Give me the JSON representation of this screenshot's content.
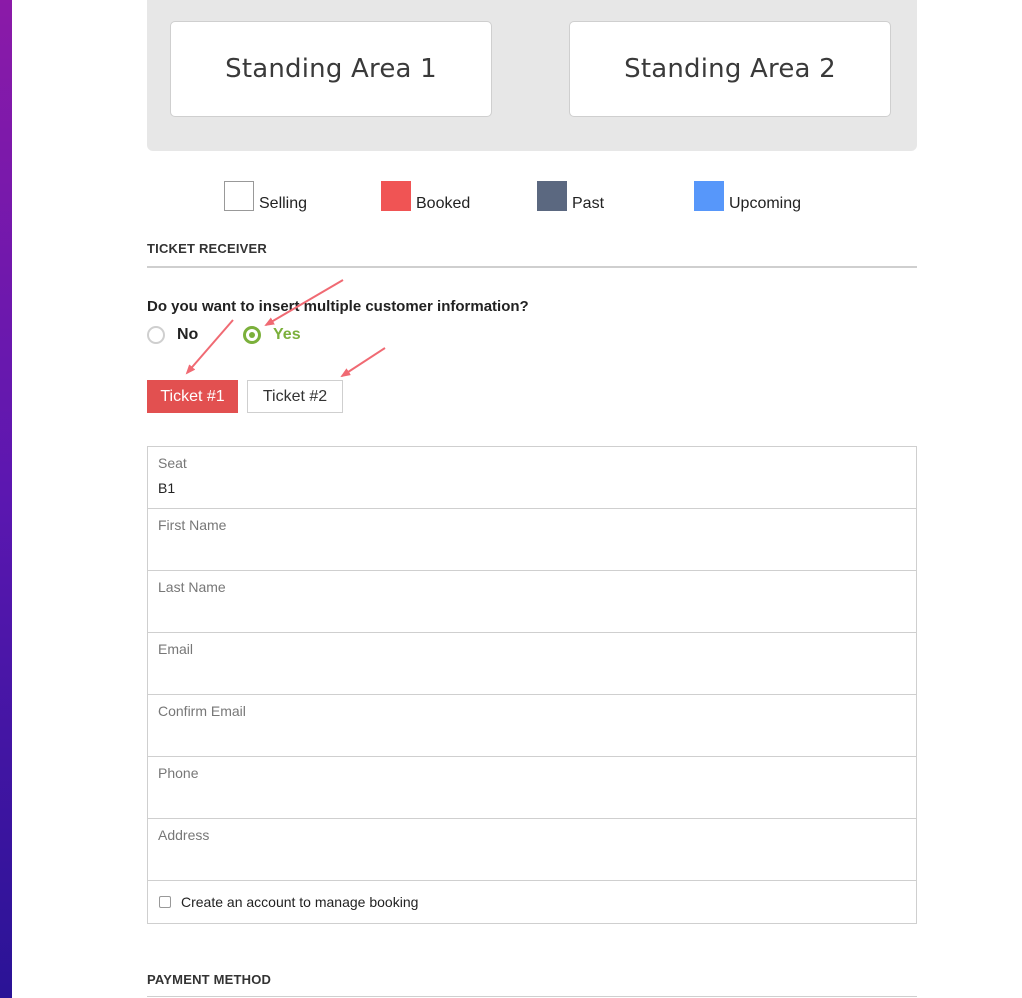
{
  "seat_map": {
    "areas": [
      "Standing Area 1",
      "Standing Area 2"
    ]
  },
  "legend": [
    {
      "label": "Selling",
      "color": "#ffffff"
    },
    {
      "label": "Booked",
      "color": "#f05454"
    },
    {
      "label": "Past",
      "color": "#5b6880"
    },
    {
      "label": "Upcoming",
      "color": "#5797fa"
    }
  ],
  "ticket_receiver": {
    "title": "TICKET RECEIVER",
    "question": "Do you want to insert multiple customer information?",
    "options": {
      "no": "No",
      "yes": "Yes"
    },
    "selected": "yes",
    "tabs": [
      "Ticket #1",
      "Ticket #2"
    ],
    "active_tab": "Ticket #1"
  },
  "form": {
    "fields": [
      {
        "label": "Seat",
        "value": "B1"
      },
      {
        "label": "First Name",
        "value": ""
      },
      {
        "label": "Last Name",
        "value": ""
      },
      {
        "label": "Email",
        "value": ""
      },
      {
        "label": "Confirm Email",
        "value": ""
      },
      {
        "label": "Phone",
        "value": ""
      },
      {
        "label": "Address",
        "value": ""
      }
    ],
    "create_account_label": "Create an account to manage booking",
    "create_account_checked": false
  },
  "payment": {
    "title": "PAYMENT METHOD"
  },
  "colors": {
    "accent_red": "#e25050",
    "accent_green": "#7bb03b",
    "annotation_arrow": "#f06a73"
  },
  "icons": {
    "checkbox": "checkbox-icon",
    "radio": "radio-icon",
    "arrow": "annotation-arrow-icon"
  }
}
